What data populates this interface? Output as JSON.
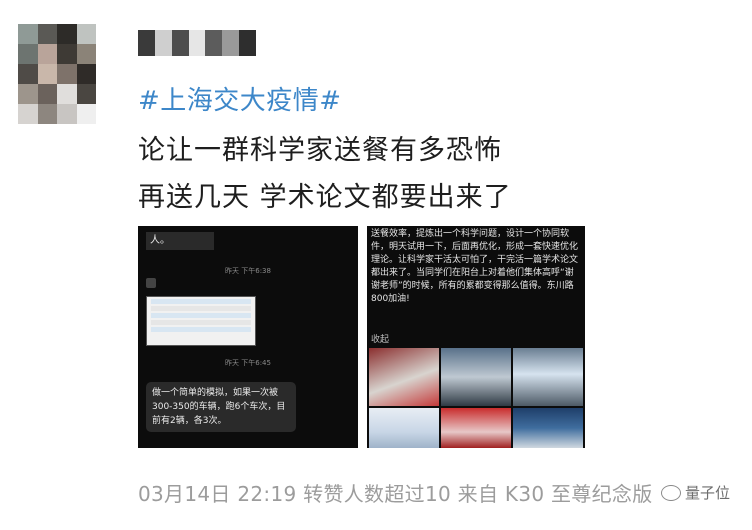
{
  "post": {
    "topic": "#上海交大疫情#",
    "line1": "论让一群科学家送餐有多恐怖",
    "line2": "再送几天 学术论文都要出来了",
    "footer": "03月14日 22:19 转赞人数超过10  来自 K30 至尊纪念版"
  },
  "left_screenshot": {
    "top_text": "人。",
    "timestamp1": "昨天 下午6:38",
    "timestamp2": "昨天 下午6:45",
    "bubble_text": "做一个简单的模拟，如果一次被300-350的车辆，跑6个车次，目前有2辆，各3次。"
  },
  "right_screenshot": {
    "paragraph": "送餐效率，提炼出一个科学问题，设计一个协同软件，明天试用一下，后面再优化，形成一套快速优化理论。让科学家干活太可怕了，干完活一篇学术论文都出来了。当同学们在阳台上对着他们集体高呼“谢谢老师”的时候，所有的累都变得那么值得。东川路800加油!",
    "label": "收起"
  },
  "watermark": {
    "text": "量子位"
  },
  "colors": {
    "topic": "#3d87c9",
    "text": "#1e1e1e",
    "footer": "#9c9c9c",
    "screenshot_bg": "#0c0c0c"
  }
}
